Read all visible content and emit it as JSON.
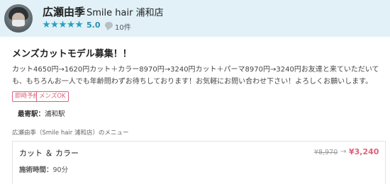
{
  "header": {
    "stylist_name": "広瀬由季",
    "salon_name": "Smile hair 浦和店",
    "rating_stars": 5,
    "rating_value": "5.0",
    "review_count": "10件",
    "accent_color": "#2a9fc0",
    "background_color": "#e1f1f7",
    "icons": [
      "avatar",
      "star-icon",
      "comment-icon"
    ]
  },
  "post": {
    "title": "メンズカットモデル募集！！",
    "body": "カット4650円→1620円カット＋カラー8970円→3240円カット＋パーマ8970円→3240円お友達と来ていただいても、もちろんお一人でも年齢問わずお待ちしております！お気軽にお問い合わせ下さい！よろしくお願いします。",
    "tags": [
      "即時予約",
      "メンズOK"
    ],
    "tag_color": "#e0607a",
    "station_label": "最寄駅：",
    "station_value": "浦和駅"
  },
  "menu": {
    "heading": "広瀬由季（Smile hair 浦和店）のメニュー",
    "items": [
      {
        "name": "カット ＆ カラー",
        "time_label": "施術時間：",
        "time_value": "90分",
        "price_old": "¥8,970",
        "arrow": "→",
        "price_new": "¥3,240"
      }
    ]
  }
}
